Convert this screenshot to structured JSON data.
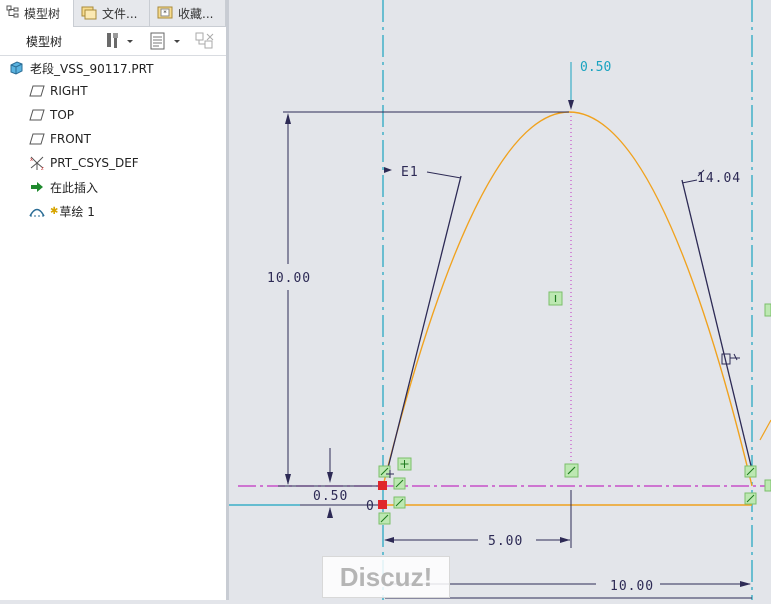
{
  "tabs": [
    {
      "label": "模型树",
      "icon": "tree-icon"
    },
    {
      "label": "文件...",
      "icon": "folder-icon"
    },
    {
      "label": "收藏...",
      "icon": "favorites-icon"
    }
  ],
  "panel": {
    "title": "模型树"
  },
  "tree": {
    "root": "老段_VSS_90117.PRT",
    "items": [
      {
        "label": "RIGHT",
        "icon": "datum-plane-icon"
      },
      {
        "label": "TOP",
        "icon": "datum-plane-icon"
      },
      {
        "label": "FRONT",
        "icon": "datum-plane-icon"
      },
      {
        "label": "PRT_CSYS_DEF",
        "icon": "csys-icon"
      },
      {
        "label": "在此插入",
        "icon": "insert-here-icon"
      },
      {
        "label": "草绘 1",
        "icon": "sketch-icon"
      }
    ]
  },
  "sketch": {
    "dims": {
      "top_offset": "0.50",
      "height": "10.00",
      "left_angle": "E1",
      "right_angle": "14.04",
      "bottom_offset": "0.50",
      "half_width": "5.00",
      "width": "10.00",
      "small_zero": "0"
    }
  },
  "watermark": "Discuz!",
  "colors": {
    "curve": "#f0a21e",
    "dimension": "#2d2a55",
    "centerline": "#1aa3c0",
    "constraint": "#c233c2"
  }
}
